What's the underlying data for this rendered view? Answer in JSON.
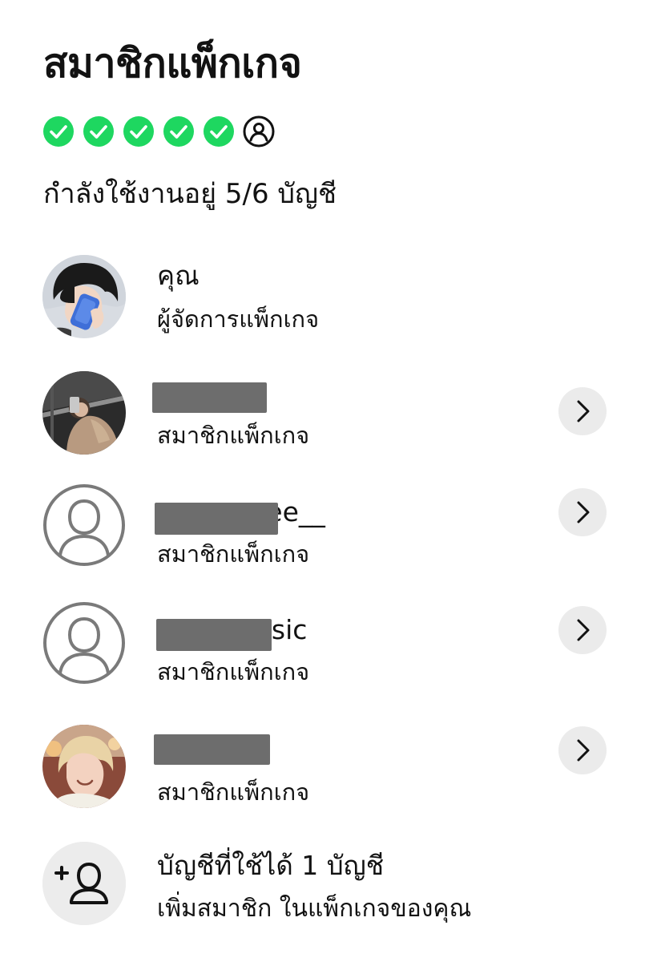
{
  "header": {
    "title": "สมาชิกแพ็กเกจ",
    "usage_text": "กำลังใช้งานอยู่ 5/6 บัญชี",
    "slots": [
      {
        "state": "filled",
        "icon": "check-circle-icon"
      },
      {
        "state": "filled",
        "icon": "check-circle-icon"
      },
      {
        "state": "filled",
        "icon": "check-circle-icon"
      },
      {
        "state": "filled",
        "icon": "check-circle-icon"
      },
      {
        "state": "filled",
        "icon": "check-circle-icon"
      },
      {
        "state": "open",
        "icon": "user-circle-icon"
      }
    ],
    "slots_used": 5,
    "slots_total": 6
  },
  "members": [
    {
      "name": "คุณ",
      "role": "ผู้จัดการแพ็กเกจ",
      "avatar": "photo",
      "has_chevron": false
    },
    {
      "name": "",
      "role": "สมาชิกแพ็กเกจ",
      "avatar": "photo",
      "has_chevron": true
    },
    {
      "name": "eee__",
      "role": "สมาชิกแพ็กเกจ",
      "avatar": "default-user-icon",
      "has_chevron": true
    },
    {
      "name": "usic",
      "role": "สมาชิกแพ็กเกจ",
      "avatar": "default-user-icon",
      "has_chevron": true
    },
    {
      "name": "",
      "role": "สมาชิกแพ็กเกจ",
      "avatar": "photo",
      "has_chevron": true
    }
  ],
  "add_member": {
    "title": "บัญชีที่ใช้ได้ 1 บัญชี",
    "subtitle": "เพิ่มสมาชิก ในแพ็กเกจของคุณ",
    "icon": "add-user-icon"
  },
  "colors": {
    "check_green": "#1ed760",
    "text": "#121212",
    "chevron_bg": "#ebebeb",
    "redaction": "#6d6d6d",
    "icon_gray": "#7a7a7a"
  }
}
